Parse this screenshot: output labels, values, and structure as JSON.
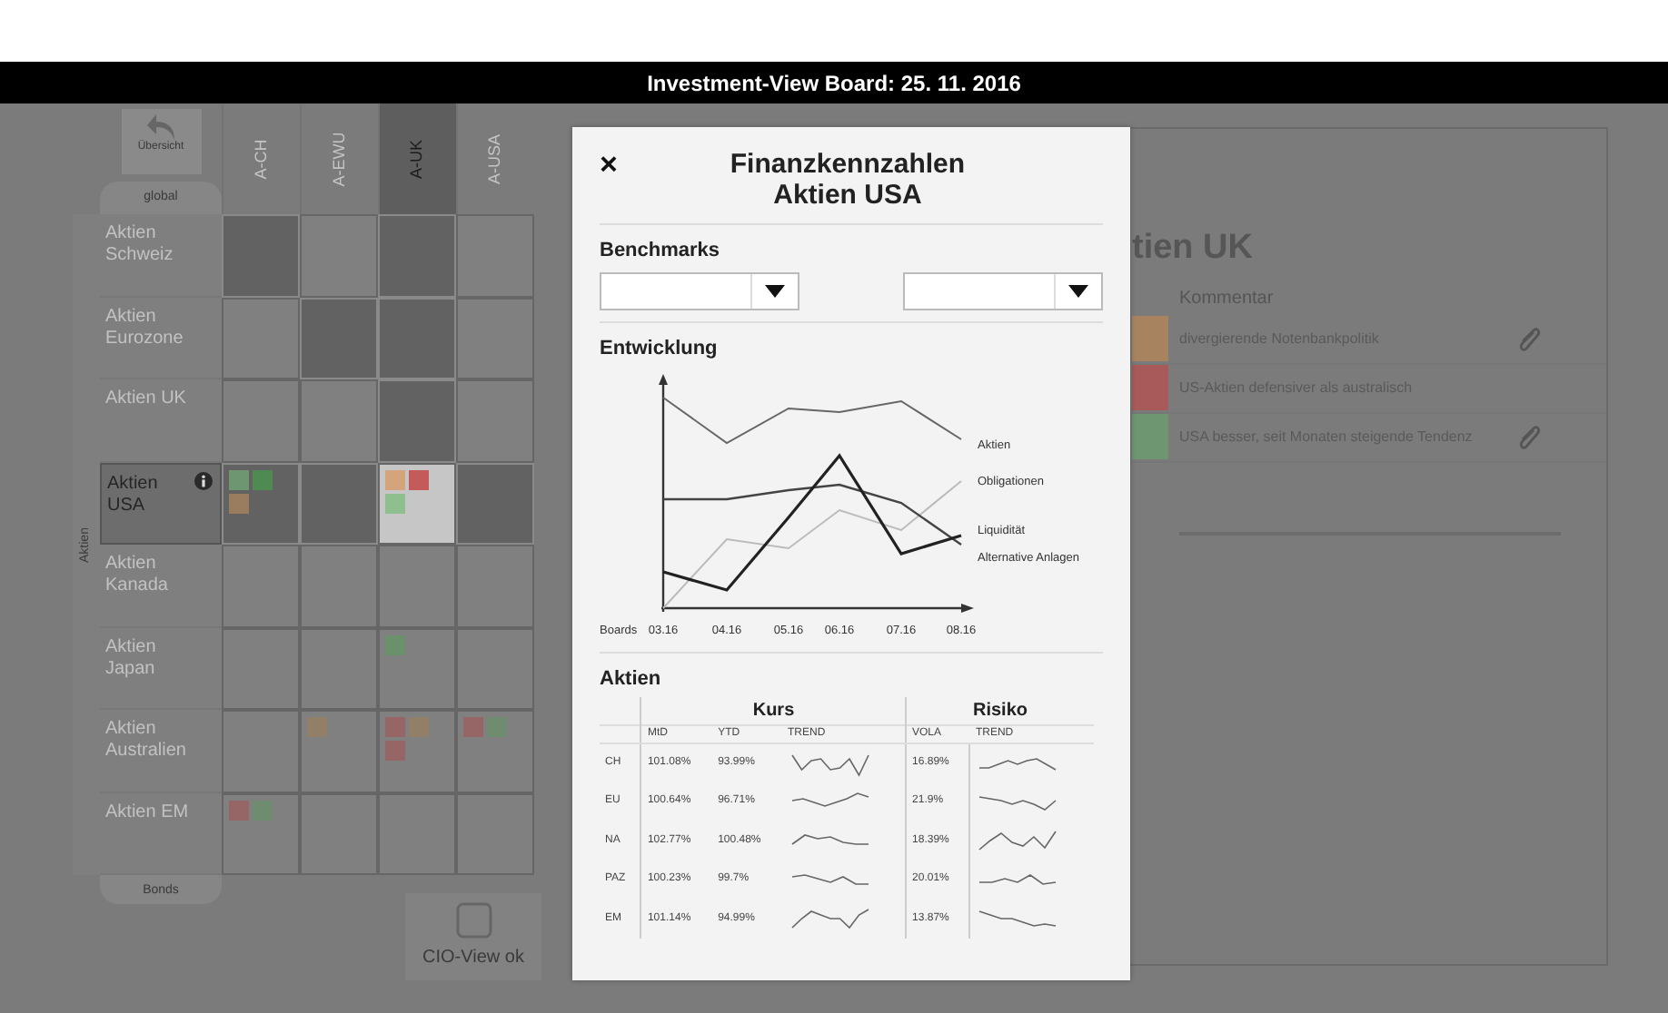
{
  "window": {
    "title": "Investment-View Board: 25. 11. 2016"
  },
  "matrix": {
    "back_button": "Übersicht",
    "top_tab": "global",
    "side_label": "Aktien",
    "bottom_tab": "Bonds",
    "columns": [
      {
        "label": "A-CH",
        "selected": false
      },
      {
        "label": "A-EWU",
        "selected": false
      },
      {
        "label": "A-UK",
        "selected": true
      },
      {
        "label": "A-USA",
        "selected": false
      }
    ],
    "rows": [
      {
        "label": "Aktien Schweiz",
        "selected": false,
        "cells": [
          {
            "shaded": true,
            "highlighted": false
          },
          {
            "shaded": false,
            "highlighted": false
          },
          {
            "shaded": true,
            "highlighted": false
          },
          {
            "shaded": false,
            "highlighted": false
          }
        ]
      },
      {
        "label": "Aktien Eurozone",
        "selected": false,
        "cells": [
          {
            "shaded": false,
            "highlighted": false
          },
          {
            "shaded": true,
            "highlighted": false
          },
          {
            "shaded": true,
            "highlighted": false
          },
          {
            "shaded": false,
            "highlighted": false
          }
        ]
      },
      {
        "label": "Aktien UK",
        "selected": false,
        "cells": [
          {
            "shaded": false,
            "highlighted": false
          },
          {
            "shaded": false,
            "highlighted": false
          },
          {
            "shaded": true,
            "highlighted": false
          },
          {
            "shaded": false,
            "highlighted": false
          }
        ]
      },
      {
        "label": "Aktien USA",
        "selected": true,
        "cells": [
          {
            "shaded": true,
            "highlighted": false,
            "squares": [
              {
                "color": "#6e9670"
              },
              {
                "color": "#4f8a52"
              },
              {
                "color": "#9a7d5e"
              }
            ]
          },
          {
            "shaded": true,
            "highlighted": false
          },
          {
            "shaded": false,
            "highlighted": true,
            "squares": [
              {
                "color": "#d4a47c"
              },
              {
                "color": "#c45b5b"
              },
              {
                "color": "#8fbf8f"
              }
            ]
          },
          {
            "shaded": true,
            "highlighted": false
          }
        ]
      },
      {
        "label": "Aktien Kanada",
        "selected": false,
        "cells": [
          {
            "shaded": false,
            "highlighted": false
          },
          {
            "shaded": false,
            "highlighted": false
          },
          {
            "shaded": false,
            "highlighted": false
          },
          {
            "shaded": false,
            "highlighted": false
          }
        ]
      },
      {
        "label": "Aktien Japan",
        "selected": false,
        "cells": [
          {
            "shaded": false,
            "highlighted": false
          },
          {
            "shaded": false,
            "highlighted": false
          },
          {
            "shaded": false,
            "highlighted": false,
            "squares": [
              {
                "color": "#6a916b"
              }
            ]
          },
          {
            "shaded": false,
            "highlighted": false
          }
        ]
      },
      {
        "label": "Aktien Australien",
        "selected": false,
        "cells": [
          {
            "shaded": false,
            "highlighted": false
          },
          {
            "shaded": false,
            "highlighted": false,
            "squares": [
              {
                "color": "#927f68"
              }
            ]
          },
          {
            "shaded": false,
            "highlighted": false,
            "squares": [
              {
                "color": "#966565"
              },
              {
                "color": "#927f68"
              },
              {
                "color": "#966565"
              }
            ]
          },
          {
            "shaded": false,
            "highlighted": false,
            "squares": [
              {
                "color": "#966565"
              },
              {
                "color": "#6f8c70"
              }
            ]
          }
        ]
      },
      {
        "label": "Aktien EM",
        "selected": false,
        "cells": [
          {
            "shaded": false,
            "highlighted": false,
            "squares": [
              {
                "color": "#966565"
              },
              {
                "color": "#6f8c70"
              }
            ]
          },
          {
            "shaded": false,
            "highlighted": false
          },
          {
            "shaded": false,
            "highlighted": false
          },
          {
            "shaded": false,
            "highlighted": false
          }
        ]
      }
    ]
  },
  "cio_view": {
    "label": "CIO-View ok",
    "checked": false
  },
  "comment_panel": {
    "title": "tien UK",
    "column": "Kommentar",
    "comments": [
      {
        "color": "#a8835f",
        "text": "divergierende Notenbankpolitik",
        "attachment": true
      },
      {
        "color": "#a85a5a",
        "text": "US-Aktien defensiver als australisch",
        "attachment": false
      },
      {
        "color": "#6e9670",
        "text": "USA besser, seit Monaten steigende Tendenz",
        "attachment": true
      }
    ]
  },
  "modal": {
    "close": "×",
    "title": "Finanzkennzahlen",
    "subtitle": "Aktien USA",
    "benchmarks": {
      "heading": "Benchmarks",
      "selects": [
        {
          "kind": "dropdown"
        },
        {
          "kind": "dropdown"
        }
      ]
    },
    "development": {
      "heading": "Entwicklung",
      "x_title": "Boards",
      "x_labels": [
        "03.16",
        "04.16",
        "05.16",
        "06.16",
        "07.16",
        "08.16"
      ],
      "series": [
        {
          "name": "Aktien"
        },
        {
          "name": "Obligationen"
        },
        {
          "name": "Liquidität"
        },
        {
          "name": "Alternative Anlagen"
        }
      ]
    },
    "table": {
      "heading": "Aktien",
      "groups": [
        "Kurs",
        "Risiko"
      ],
      "columns": [
        "MtD",
        "YTD",
        "TREND",
        "VOLA",
        "TREND"
      ],
      "rows": [
        {
          "region": "CH",
          "mtd": "101.08%",
          "ytd": "93.99%",
          "vola": "16.89%"
        },
        {
          "region": "EU",
          "mtd": "100.64%",
          "ytd": "96.71%",
          "vola": "21.9%"
        },
        {
          "region": "NA",
          "mtd": "102.77%",
          "ytd": "100.48%",
          "vola": "18.39%"
        },
        {
          "region": "PAZ",
          "mtd": "100.23%",
          "ytd": "99.7%",
          "vola": "20.01%"
        },
        {
          "region": "EM",
          "mtd": "101.14%",
          "ytd": "94.99%",
          "vola": "13.87%"
        }
      ]
    }
  }
}
